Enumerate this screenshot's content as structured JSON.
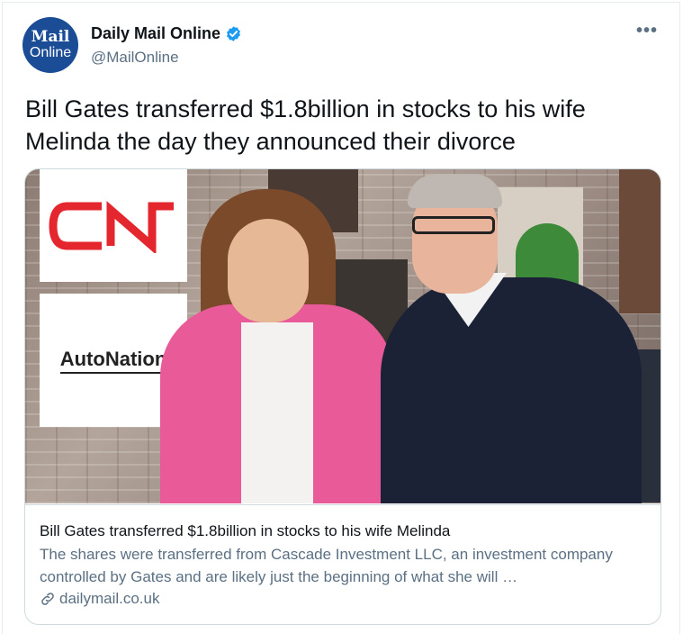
{
  "author": {
    "avatar_line1": "Mail",
    "avatar_line2": "Online",
    "display_name": "Daily Mail Online",
    "handle": "@MailOnline",
    "verified_icon": "verified-badge-icon"
  },
  "more_label": "•••",
  "tweet": {
    "text": "Bill Gates transferred $1.8billion in stocks to his wife Melinda the day they announced their divorce"
  },
  "card": {
    "image": {
      "logo_top": "CN",
      "logo_bottom": "AutoNation"
    },
    "title": "Bill Gates transferred $1.8billion in stocks to his wife Melinda",
    "description": "The shares were transferred from Cascade Investment LLC, an investment company controlled by Gates and are likely just the beginning of what she will …",
    "domain": "dailymail.co.uk",
    "link_icon": "link-icon"
  },
  "colors": {
    "brand_blue": "#1b4c96",
    "verified_blue": "#1d9bf0",
    "cn_red": "#e4262e",
    "muted_text": "#5b7083"
  }
}
